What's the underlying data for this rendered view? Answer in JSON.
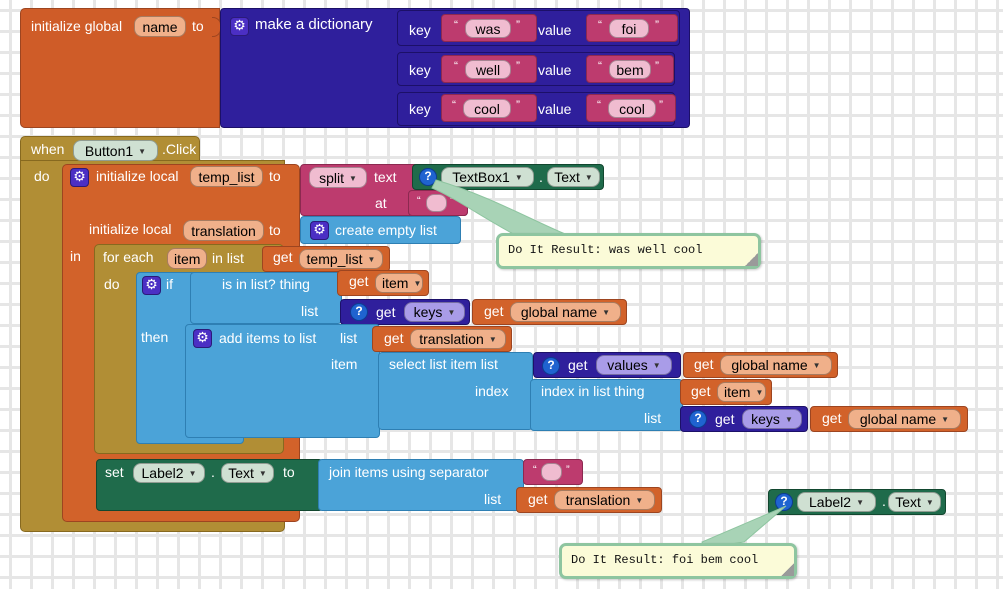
{
  "app": {
    "title": "MIT App Inventor - Blocks Editor",
    "canvas_background": "#ffffff",
    "grid_color": "#e6e6e6"
  },
  "colors": {
    "variable_orange": "#cf5c28",
    "dictionary_purple": "#2f1f9c",
    "text_pink": "#bd3b6e",
    "control_gold": "#b18e35",
    "list_blue": "#4ba3d8",
    "component_green": "#1f6b4b",
    "lexical_orange": "#d2622a",
    "balloon_yellow": "#fbfbd8",
    "balloon_border": "#8ec5a0"
  },
  "blocks": {
    "global_def": {
      "init_global": "initialize global",
      "var_name": "name",
      "to": "to",
      "make_dictionary": "make a dictionary",
      "pairs": [
        {
          "key_label": "key",
          "key_value": "was",
          "value_label": "value",
          "value_value": "foi"
        },
        {
          "key_label": "key",
          "key_value": "well",
          "value_label": "value",
          "value_value": "bem"
        },
        {
          "key_label": "key",
          "key_value": "cool",
          "value_label": "value",
          "value_value": "cool"
        }
      ]
    },
    "event": {
      "when": "when",
      "component": "Button1",
      "event_name": ".Click",
      "do": "do"
    },
    "local_temp_list": {
      "init_local": "initialize local",
      "name": "temp_list",
      "to": "to",
      "split": "split",
      "text_label": "text",
      "at_label": "at",
      "at_value": " ",
      "textbox_component": "TextBox1",
      "textbox_dot": ".",
      "textbox_property": "Text"
    },
    "local_translation": {
      "init_local": "initialize local",
      "name": "translation",
      "to": "to",
      "create_empty_list": "create empty list",
      "in": "in"
    },
    "for_each": {
      "for_each": "for each",
      "loop_var": "item",
      "in_list": "in list",
      "get": "get",
      "list_var": "temp_list",
      "do": "do"
    },
    "if_block": {
      "if": "if",
      "then": "then",
      "is_in_list": "is in list?  thing",
      "thing_get": "get",
      "thing_var": "item",
      "list_label": "list",
      "keys_get": "get",
      "keys_var": "keys",
      "global_get": "get",
      "global_var": "global name"
    },
    "add_items": {
      "add_items_to_list": "add items to list",
      "list_label": "list",
      "list_get": "get",
      "list_var": "translation",
      "item_label": "item",
      "select_list_item": "select list item  list",
      "values_get": "get",
      "values_var": "values",
      "values_global_get": "get",
      "values_global_var": "global name",
      "index_label": "index",
      "index_in_list": "index in list  thing",
      "thing_get": "get",
      "thing_var": "item",
      "index_list_label": "list",
      "index_keys_get": "get",
      "index_keys_var": "keys",
      "index_global_get": "get",
      "index_global_var": "global name"
    },
    "set_label": {
      "set": "set",
      "component": "Label2",
      "dot": ".",
      "property": "Text",
      "to": "to",
      "join_items": "join items using separator",
      "separator_value": " ",
      "list_label": "list",
      "list_get": "get",
      "list_var": "translation"
    },
    "floating_label2": {
      "component": "Label2",
      "dot": ".",
      "property": "Text"
    }
  },
  "results": {
    "top": "Do It Result: was well cool",
    "bottom": "Do It Result: foi bem cool"
  }
}
